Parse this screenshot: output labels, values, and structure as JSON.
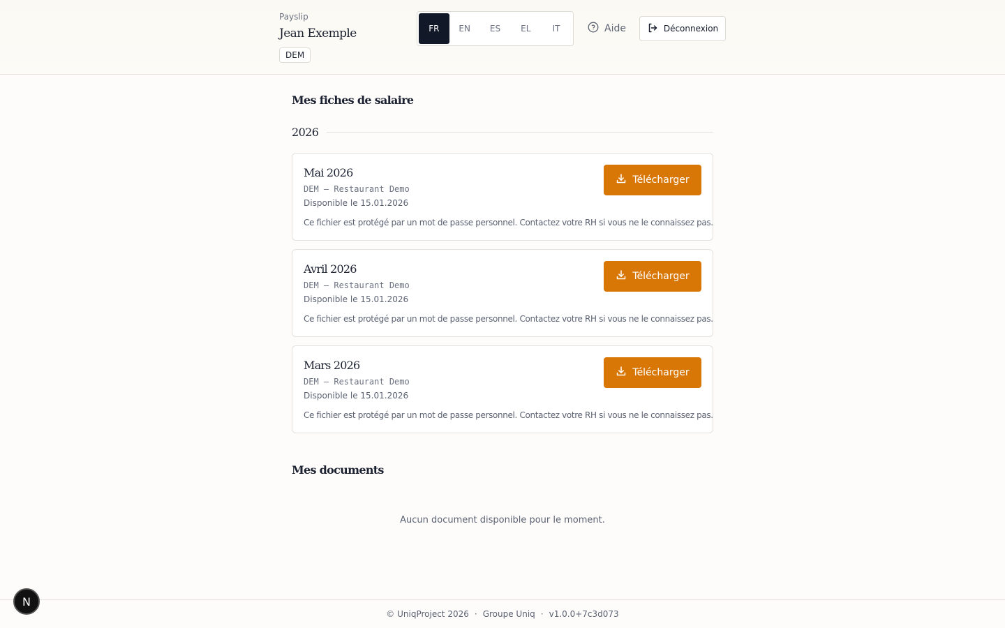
{
  "header": {
    "app_name": "Payslip",
    "user_name": "Jean Exemple",
    "company_badge": "DEM",
    "languages": [
      {
        "code": "FR",
        "active": true
      },
      {
        "code": "EN",
        "active": false
      },
      {
        "code": "ES",
        "active": false
      },
      {
        "code": "EL",
        "active": false
      },
      {
        "code": "IT",
        "active": false
      }
    ],
    "help_label": "Aide",
    "logout_label": "Déconnexion"
  },
  "payslips": {
    "section_title": "Mes fiches de salaire",
    "year": "2026",
    "items": [
      {
        "title": "Mai 2026",
        "meta": "DEM — Restaurant Demo",
        "date": "Disponible le 15.01.2026",
        "note": "Ce fichier est protégé par un mot de passe personnel. Contactez votre RH si vous ne le connaissez pas.",
        "download_label": "Télécharger"
      },
      {
        "title": "Avril 2026",
        "meta": "DEM — Restaurant Demo",
        "date": "Disponible le 15.01.2026",
        "note": "Ce fichier est protégé par un mot de passe personnel. Contactez votre RH si vous ne le connaissez pas.",
        "download_label": "Télécharger"
      },
      {
        "title": "Mars 2026",
        "meta": "DEM — Restaurant Demo",
        "date": "Disponible le 15.01.2026",
        "note": "Ce fichier est protégé par un mot de passe personnel. Contactez votre RH si vous ne le connaissez pas.",
        "download_label": "Télécharger"
      }
    ]
  },
  "documents": {
    "section_title": "Mes documents",
    "empty_message": "Aucun document disponible pour le moment."
  },
  "footer": {
    "copyright": "© UniqProject 2026",
    "separator": "·",
    "company": "Groupe Uniq",
    "version": "v1.0.0+7c3d073"
  },
  "dev_badge": {
    "label": "N"
  },
  "colors": {
    "accent": "#d97706",
    "active_lang": "#111827"
  }
}
